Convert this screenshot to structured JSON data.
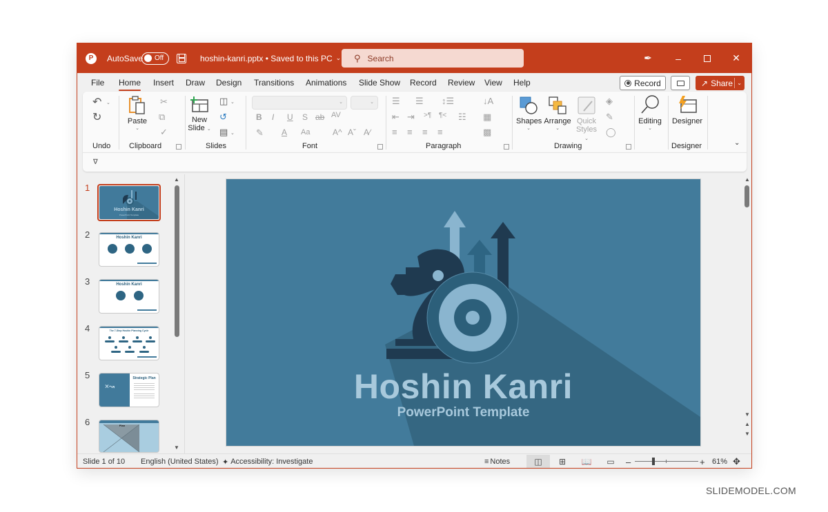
{
  "titlebar": {
    "app_icon": "powerpoint-logo-icon",
    "autosave_label": "AutoSave",
    "autosave_state": "Off",
    "save_icon": "save-icon",
    "file_name": "hoshin-kanri.pptx",
    "save_status": "• Saved to this PC",
    "search_placeholder": "Search",
    "pen_icon": "pen-icon",
    "minimize_icon": "minimize-icon",
    "maximize_icon": "maximize-icon",
    "close_icon": "close-icon"
  },
  "menu": {
    "tabs": [
      {
        "label": "File"
      },
      {
        "label": "Home",
        "active": true
      },
      {
        "label": "Insert"
      },
      {
        "label": "Draw"
      },
      {
        "label": "Design"
      },
      {
        "label": "Transitions"
      },
      {
        "label": "Animations"
      },
      {
        "label": "Slide Show"
      },
      {
        "label": "Record"
      },
      {
        "label": "Review"
      },
      {
        "label": "View"
      },
      {
        "label": "Help"
      }
    ],
    "record_button": "Record",
    "share_button": "Share"
  },
  "ribbon": {
    "groups": {
      "undo": "Undo",
      "clipboard": "Clipboard",
      "slides": "Slides",
      "font": "Font",
      "paragraph": "Paragraph",
      "drawing": "Drawing",
      "designer": "Designer"
    },
    "buttons": {
      "paste": "Paste",
      "new_slide_line1": "New",
      "new_slide_line2": "Slide",
      "shapes": "Shapes",
      "arrange": "Arrange",
      "quick_styles_line1": "Quick",
      "quick_styles_line2": "Styles",
      "editing": "Editing",
      "designer": "Designer"
    },
    "font_buttons": {
      "bold": "B",
      "italic": "I",
      "underline": "U",
      "shadow": "S",
      "strike": "ab",
      "spacing": "AV",
      "font_color": "A",
      "change_case": "Aa",
      "grow": "A^",
      "shrink": "Aˇ"
    },
    "font_name_value": "",
    "font_size_value": ""
  },
  "thumbnails": [
    {
      "number": "1",
      "active": true,
      "title": "Hoshin Kanri",
      "subtitle": "PowerPoint Template"
    },
    {
      "number": "2",
      "title": "Hoshin Kanri"
    },
    {
      "number": "3",
      "title": "Hoshin Kanri"
    },
    {
      "number": "4",
      "title": "The 7-Step Hoshin Planning Cycle"
    },
    {
      "number": "5",
      "title": "Strategic Plan"
    },
    {
      "number": "6",
      "title": "Plan"
    }
  ],
  "slide": {
    "title": "Hoshin Kanri",
    "subtitle": "PowerPoint Template",
    "colors": {
      "background": "#427b9b",
      "dark": "#1f3a50",
      "mid": "#2c5f7a",
      "light": "#8ab5cf",
      "shadow": "#356782"
    }
  },
  "statusbar": {
    "slide_counter": "Slide 1 of 10",
    "language": "English (United States)",
    "accessibility": "Accessibility: Investigate",
    "notes": "Notes",
    "zoom_level": "61%",
    "zoom_percent": 61
  },
  "watermark": "SLIDEMODEL.COM",
  "colors": {
    "accent": "#c43e1c",
    "search_bg": "#f5d9d1"
  }
}
